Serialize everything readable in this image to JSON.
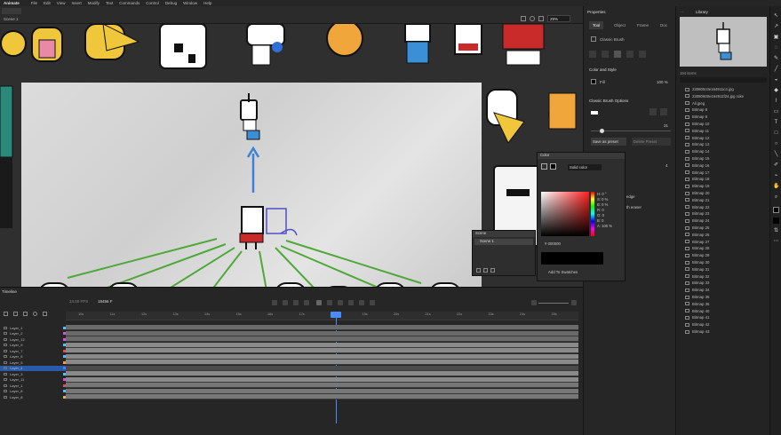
{
  "menubar": {
    "app_name": "Animate",
    "items": [
      "File",
      "Edit",
      "View",
      "Insert",
      "Modify",
      "Text",
      "Commands",
      "Control",
      "Debug",
      "Window",
      "Help"
    ]
  },
  "stage": {
    "scene_label": "Scene 1",
    "zoom": "29%"
  },
  "properties": {
    "panel_title": "Properties",
    "tabs": [
      "Tool",
      "Object",
      "Frame",
      "Doc"
    ],
    "active_tab": "Tool",
    "tool_name": "Classic Brush",
    "color_style_header": "Color and Style",
    "fill_label": "Fill",
    "fill_opacity": "100 %",
    "brush_options_header": "Classic Brush Options",
    "size_value": "31",
    "save_preset": "Save as preset",
    "delete_preset": "Delete Preset",
    "edge_label": "edge",
    "eraser_label": "th eraser",
    "value_4": "4"
  },
  "library": {
    "panel_title": "Library",
    "item_count": "194 items",
    "items": [
      "230805c0e164911c4.jpg",
      "23080600e164911f24.jpg roke",
      "Ali.jpeg",
      "Bitmap 8",
      "Bitmap 9",
      "Bitmap 10",
      "Bitmap 11",
      "Bitmap 12",
      "Bitmap 13",
      "Bitmap 14",
      "Bitmap 15",
      "Bitmap 16",
      "Bitmap 17",
      "Bitmap 18",
      "Bitmap 19",
      "Bitmap 20",
      "Bitmap 21",
      "Bitmap 22",
      "Bitmap 23",
      "Bitmap 24",
      "Bitmap 25",
      "Bitmap 26",
      "Bitmap 27",
      "Bitmap 28",
      "Bitmap 29",
      "Bitmap 30",
      "Bitmap 31",
      "Bitmap 32",
      "Bitmap 33",
      "Bitmap 34",
      "Bitmap 35",
      "Bitmap 36",
      "Bitmap 40",
      "Bitmap 41",
      "Bitmap 42",
      "Bitmap 43"
    ]
  },
  "color_panel": {
    "title": "Color",
    "type": "Solid color",
    "hex": "000000",
    "h": "0 °",
    "s": "0 %",
    "b": "0 %",
    "r": "0",
    "g": "0",
    "bl": "0",
    "a": "100 %",
    "add_swatch": "Add To Swatches",
    "label_h": "H:",
    "label_s": "S:",
    "label_b": "B:",
    "label_r": "R:",
    "label_g": "G:",
    "label_bl": "B:",
    "label_a": "A:"
  },
  "scene_panel": {
    "title": "Scene",
    "scene_item": "Scene 1"
  },
  "timeline": {
    "title": "Timeline",
    "fps": "24.00",
    "fps_unit": "FPS",
    "frame": "18456",
    "frame_suffix": "F",
    "ruler": [
      "10s",
      "11s",
      "12s",
      "13s",
      "14s",
      "15s",
      "16s",
      "17s",
      "18s",
      "19s",
      "20s",
      "21s",
      "22s",
      "23s",
      "24s",
      "25s"
    ],
    "layers": [
      {
        "name": "Layer_1",
        "color": "#4ec0ff"
      },
      {
        "name": "Layer_2",
        "color": "#e24fd6"
      },
      {
        "name": "Layer_12",
        "color": "#e24fd6"
      },
      {
        "name": "Layer_9",
        "color": "#4ec0ff"
      },
      {
        "name": "Layer_7",
        "color": "#e24f4f"
      },
      {
        "name": "Layer_6",
        "color": "#4ec0ff"
      },
      {
        "name": "Layer_5",
        "color": "#ff9a2e"
      },
      {
        "name": "Layer_4",
        "color": "#4e7cff"
      },
      {
        "name": "Layer_3",
        "color": "#4ec0ff"
      },
      {
        "name": "Layer_11",
        "color": "#e24fd6"
      },
      {
        "name": "Layer_1",
        "color": "#e24f4f"
      },
      {
        "name": "Layer_8",
        "color": "#4ec0ff"
      },
      {
        "name": "Layer_8",
        "color": "#e2b44f"
      }
    ]
  },
  "colors": {
    "accent_blue": "#2b6fd6",
    "playhead": "#4a8cff",
    "arrow_green": "#4fa83a",
    "arrow_blue": "#3b82d6"
  }
}
